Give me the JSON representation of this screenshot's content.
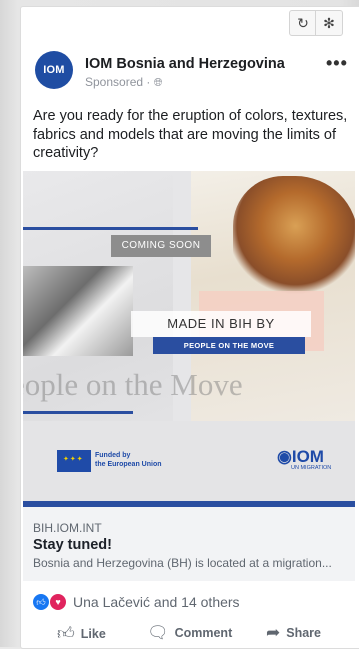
{
  "toolbar": {
    "refresh_icon": "refresh-icon",
    "bug_icon": "bug-icon"
  },
  "post": {
    "page_name": "IOM Bosnia and Herzegovina",
    "sponsored_label": "Sponsored · ",
    "avatar_text": "IOM",
    "text": "Are you ready for the eruption of colors, textures, fabrics and models that are moving the limits of creativity?"
  },
  "media": {
    "coming_soon": "COMING SOON",
    "made_in": "MADE IN BIH BY",
    "people_bar": "PEOPLE ON THE MOVE",
    "big_text": "eople on the Move",
    "eu_line1": "Funded by",
    "eu_line2": "the European Union",
    "iom_logo": "IOM",
    "iom_sub": "UN MIGRATION"
  },
  "link": {
    "domain": "BIH.IOM.INT",
    "title": "Stay tuned!",
    "description": "Bosnia and Herzegovina (BH) is located at a migration..."
  },
  "reactions": {
    "summary": "Una Lačević and 14 others"
  },
  "actions": {
    "like": "Like",
    "comment": "Comment",
    "share": "Share"
  },
  "colors": {
    "brand_blue": "#2a4ea0",
    "like_blue": "#1877f2",
    "love_red": "#e0245e"
  }
}
